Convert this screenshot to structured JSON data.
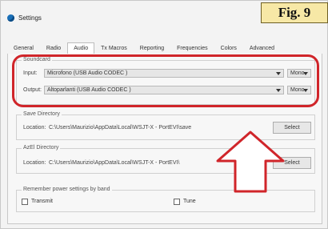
{
  "window": {
    "title": "Settings",
    "figure_label": "Fig. 9"
  },
  "tabs": [
    {
      "label": "General",
      "active": false
    },
    {
      "label": "Radio",
      "active": false
    },
    {
      "label": "Audio",
      "active": true
    },
    {
      "label": "Tx Macros",
      "active": false
    },
    {
      "label": "Reporting",
      "active": false
    },
    {
      "label": "Frequencies",
      "active": false
    },
    {
      "label": "Colors",
      "active": false
    },
    {
      "label": "Advanced",
      "active": false
    }
  ],
  "soundcard": {
    "title": "Soundcard",
    "input_label": "Input:",
    "input_value": "Microfono (USB Audio CODEC )",
    "input_channel": "Mono",
    "output_label": "Output:",
    "output_value": "Altoparlanti (USB Audio CODEC )",
    "output_channel": "Mono"
  },
  "save_directory": {
    "title": "Save Directory",
    "location_label": "Location:",
    "location_value": "C:\\Users\\Maurizio\\AppData\\Local\\WSJT-X - PortEVI\\save",
    "select_label": "Select"
  },
  "azel_directory": {
    "title": "AzEl Directory",
    "location_label": "Location:",
    "location_value": "C:\\Users\\Maurizio\\AppData\\Local\\WSJT-X - PortEVI\\",
    "select_label": "Select"
  },
  "power_settings": {
    "title": "Remember power settings by band",
    "transmit_label": "Transmit",
    "transmit_checked": false,
    "tune_label": "Tune",
    "tune_checked": false
  },
  "annotation_color": "#d0252a"
}
